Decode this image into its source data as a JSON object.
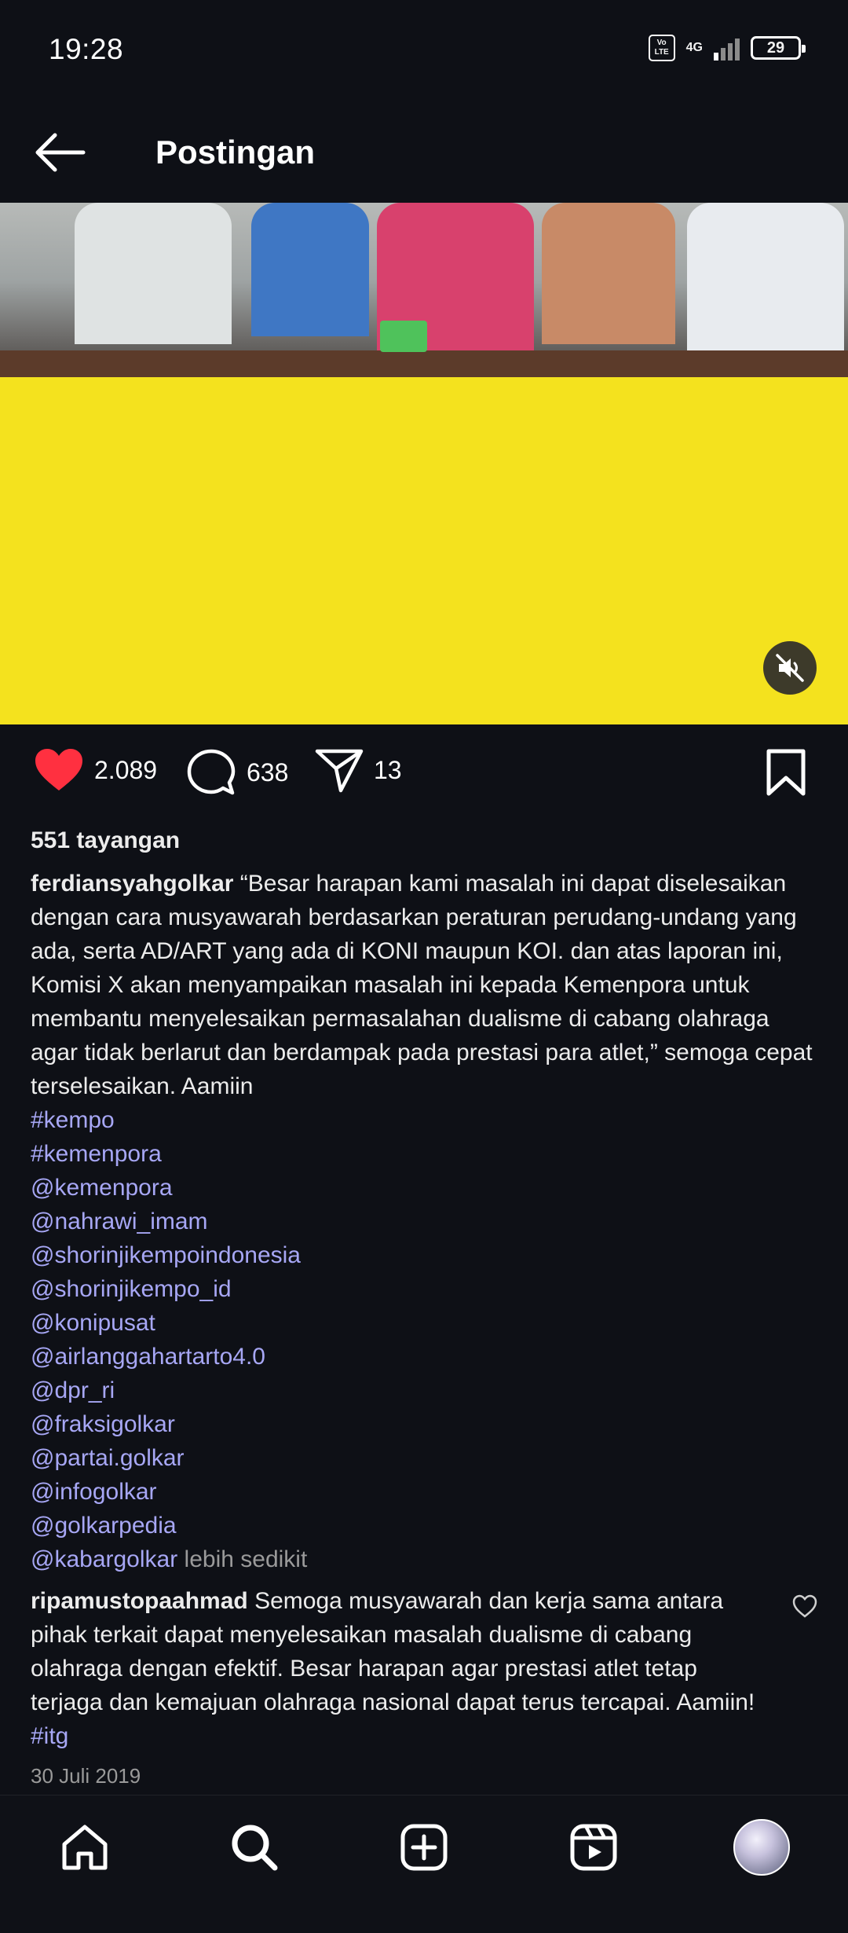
{
  "status_bar": {
    "time": "19:28",
    "network_label": "4G",
    "volte_label": "Vo LTE",
    "battery_level": "29"
  },
  "header": {
    "title": "Postingan"
  },
  "media": {
    "background_color": "#f4e21e",
    "mute_icon": "speaker-muted-icon"
  },
  "actions": {
    "likes": "2.089",
    "comments": "638",
    "shares": "13",
    "like_color": "#ff3040"
  },
  "post": {
    "views": "551 tayangan",
    "username": "ferdiansyahgolkar",
    "caption": " “Besar harapan kami masalah  ini dapat diselesaikan dengan cara musyawarah berdasarkan peraturan perudang-undang yang ada, serta AD/ART yang ada di KONI maupun KOI. dan atas laporan ini, Komisi X akan menyampaikan masalah ini kepada Kemenpora untuk membantu menyelesaikan permasalahan dualisme di cabang olahraga agar tidak berlarut dan berdampak pada prestasi para atlet,” semoga cepat terselesaikan. Aamiin",
    "tags": [
      "#kempo",
      "#kemenpora",
      "@kemenpora",
      "@nahrawi_imam",
      "@shorinjikempoindonesia",
      "@shorinjikempo_id",
      "@konipusat",
      "@airlanggahartarto4.0",
      "@dpr_ri",
      "@fraksigolkar",
      "@partai.golkar",
      "@infogolkar",
      "@golkarpedia"
    ],
    "last_tag": "@kabargolkar",
    "more_label": " lebih sedikit"
  },
  "top_comment": {
    "username": "ripamustopaahmad",
    "text": " Semoga musyawarah dan kerja sama antara pihak terkait dapat menyelesaikan masalah dualisme di cabang olahraga dengan efektif. Besar harapan agar prestasi atlet tetap terjaga dan kemajuan olahraga nasional dapat terus tercapai. Aamiin! ",
    "hashtag": "#itg"
  },
  "date": "30 Juli 2019",
  "tag_color": "#a7a7f5"
}
